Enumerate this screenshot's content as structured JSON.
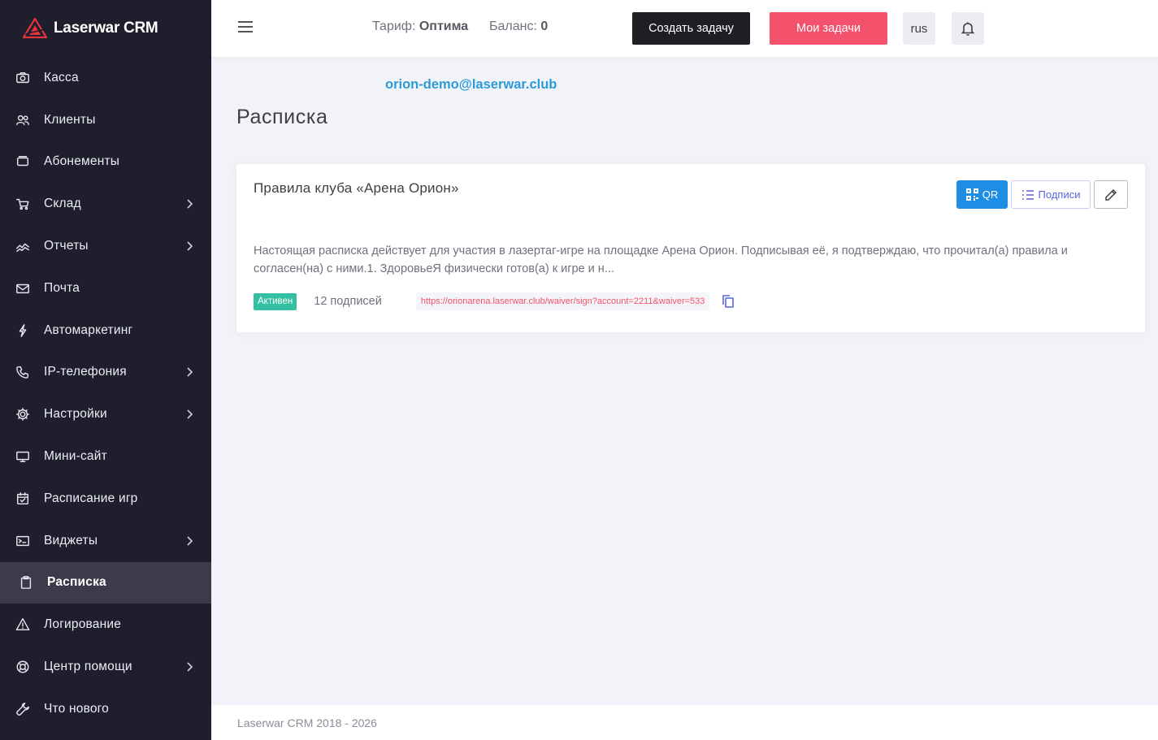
{
  "brand": {
    "name": "Laserwar CRM",
    "logo_color": "#e0353b"
  },
  "sidebar": {
    "items": [
      {
        "label": "Касса",
        "icon": "camera-icon",
        "has_children": false
      },
      {
        "label": "Клиенты",
        "icon": "users-icon",
        "has_children": false
      },
      {
        "label": "Абонементы",
        "icon": "cards-icon",
        "has_children": false
      },
      {
        "label": "Склад",
        "icon": "cart-icon",
        "has_children": true
      },
      {
        "label": "Отчеты",
        "icon": "chart-icon",
        "has_children": true
      },
      {
        "label": "Почта",
        "icon": "mail-icon",
        "has_children": false
      },
      {
        "label": "Автомаркетинг",
        "icon": "lightning-icon",
        "has_children": false
      },
      {
        "label": "IP-телефония",
        "icon": "phone-icon",
        "has_children": true
      },
      {
        "label": "Настройки",
        "icon": "gear-icon",
        "has_children": true
      },
      {
        "label": "Мини-сайт",
        "icon": "monitor-icon",
        "has_children": false
      },
      {
        "label": "Расписание игр",
        "icon": "calendar-check-icon",
        "has_children": false
      },
      {
        "label": "Виджеты",
        "icon": "terminal-icon",
        "has_children": true
      },
      {
        "label": "Расписка",
        "icon": "clipboard-icon",
        "has_children": false,
        "active": true
      },
      {
        "label": "Логирование",
        "icon": "warning-icon",
        "has_children": false
      },
      {
        "label": "Центр помощи",
        "icon": "lifebuoy-icon",
        "has_children": true
      },
      {
        "label": "Что нового",
        "icon": "wrench-icon",
        "has_children": false
      }
    ]
  },
  "topbar": {
    "tariff_label": "Тариф:",
    "tariff_value": "Оптима",
    "balance_label": "Баланс:",
    "balance_value": "0",
    "create_task": "Создать задачу",
    "my_tasks": "Мои задачи",
    "lang": "rus"
  },
  "main": {
    "email": "orion-demo@laserwar.club",
    "page_title": "Расписка",
    "card": {
      "title": "Правила клуба «Арена Орион»",
      "qr_label": "QR",
      "signatures_label": "Подписи",
      "description": "Настоящая расписка действует для участия в лазертаг-игре на площадке Арена Орион. Подписывая её, я подтверждаю, что прочитал(а) правила и согласен(на) с ними.1. ЗдоровьеЯ физически готов(а) к игре и н...",
      "status": "Активен",
      "signature_count": "12 подписей",
      "link": "https://orionarena.laserwar.club/waiver/sign?account=2211&waiver=533"
    }
  },
  "footer": {
    "text": "Laserwar CRM 2018 - 2026"
  },
  "colors": {
    "sidebar_bg": "#1e1e2d",
    "accent_blue": "#1e8ee5",
    "accent_red": "#f4516c",
    "success": "#34bfa3",
    "link_blue": "#2b9bd9"
  }
}
